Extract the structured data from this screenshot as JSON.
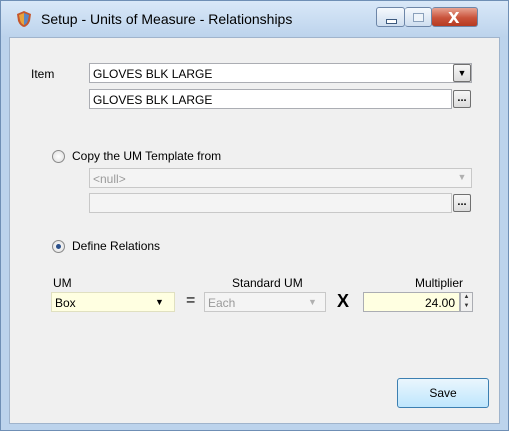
{
  "window": {
    "title": "Setup - Units of Measure - Relationships",
    "icon": "shield-icon",
    "controls": [
      "minimize",
      "maximize",
      "close"
    ]
  },
  "item": {
    "label": "Item",
    "value": "GLOVES BLK LARGE",
    "description": "GLOVES BLK LARGE"
  },
  "copy_template": {
    "label": "Copy the UM Template from",
    "selected": false,
    "value": "<null>",
    "description": ""
  },
  "define_relations": {
    "label": "Define Relations",
    "selected": true,
    "um_label": "UM",
    "um_value": "Box",
    "equals": "=",
    "standard_um_label": "Standard UM",
    "standard_um_value": "Each",
    "times": "X",
    "multiplier_label": "Multiplier",
    "multiplier_value": "24.00"
  },
  "buttons": {
    "save": "Save",
    "ellipsis": "..."
  }
}
